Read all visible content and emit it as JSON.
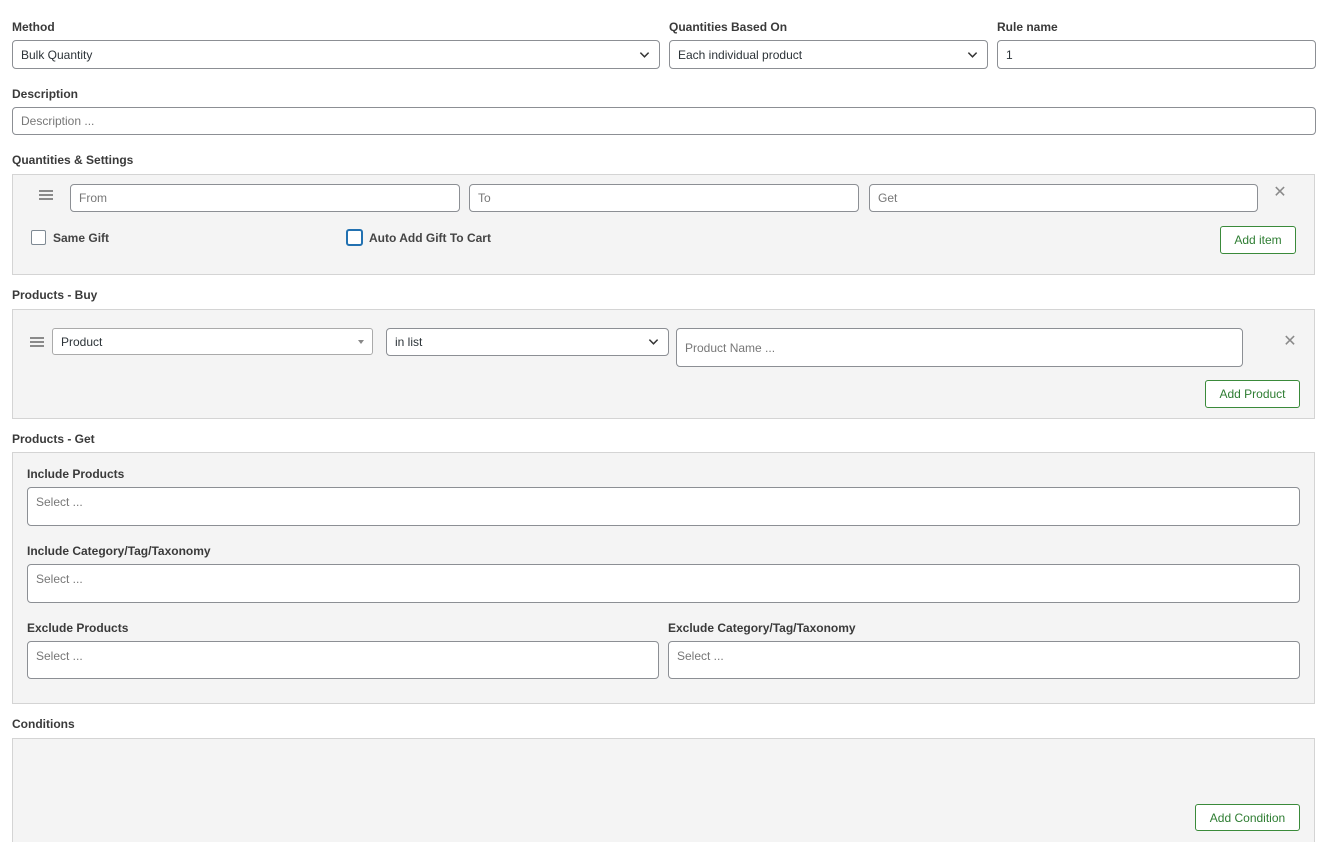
{
  "method": {
    "label": "Method",
    "value": "Bulk Quantity"
  },
  "quantities_based_on": {
    "label": "Quantities Based On",
    "value": "Each individual product"
  },
  "rule_name": {
    "label": "Rule name",
    "value": "1"
  },
  "description": {
    "label": "Description",
    "placeholder": "Description ..."
  },
  "quantities_settings": {
    "label": "Quantities & Settings",
    "from_placeholder": "From",
    "to_placeholder": "To",
    "get_placeholder": "Get",
    "same_gift_label": "Same Gift",
    "auto_add_label": "Auto Add Gift To Cart",
    "add_item_label": "Add item"
  },
  "products_buy": {
    "label": "Products - Buy",
    "type_value": "Product",
    "operator_value": "in list",
    "name_placeholder": "Product Name ...",
    "add_product_label": "Add Product"
  },
  "products_get": {
    "label": "Products - Get",
    "include_products_label": "Include Products",
    "include_products_placeholder": "Select ...",
    "include_category_label": "Include Category/Tag/Taxonomy",
    "include_category_placeholder": "Select ...",
    "exclude_products_label": "Exclude Products",
    "exclude_products_placeholder": "Select ...",
    "exclude_category_label": "Exclude Category/Tag/Taxonomy",
    "exclude_category_placeholder": "Select ..."
  },
  "conditions": {
    "label": "Conditions",
    "add_condition_label": "Add Condition"
  },
  "icons": {
    "remove": "close-icon",
    "drag": "drag-handle-icon",
    "dropdown": "chevron-down-icon"
  }
}
